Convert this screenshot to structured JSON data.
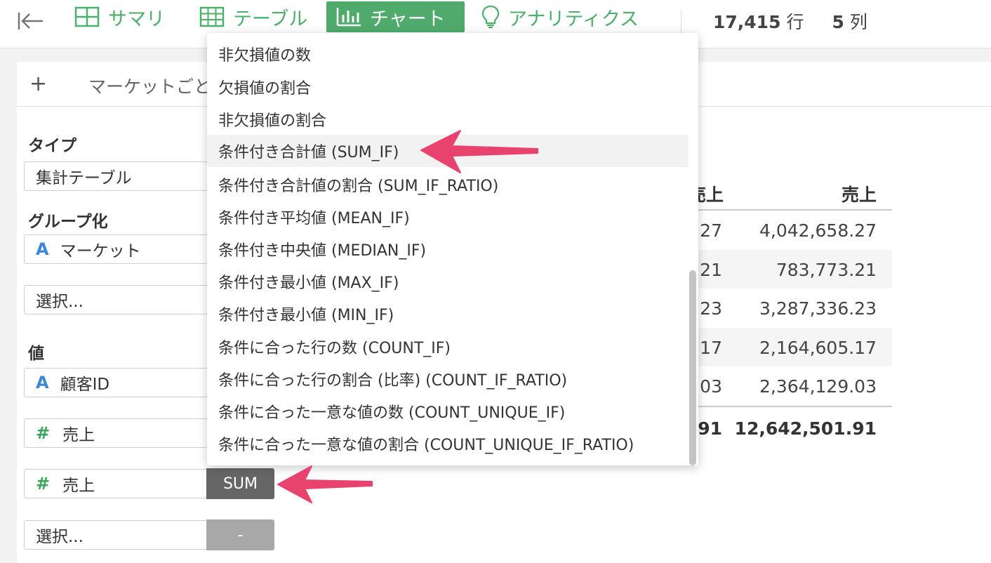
{
  "toolbar": {
    "tabs": [
      {
        "label": "サマリ",
        "icon": "grid-icon"
      },
      {
        "label": "テーブル",
        "icon": "table-icon"
      },
      {
        "label": "チャート",
        "icon": "bar-chart-icon"
      },
      {
        "label": "アナリティクス",
        "icon": "lightbulb-icon"
      }
    ],
    "active_tab": "チャート",
    "rows_count": "17,415",
    "rows_unit": "行",
    "cols_count": "5",
    "cols_unit": "列"
  },
  "panel": {
    "add_label": "+",
    "chart_tab_label": "マーケットごと"
  },
  "config": {
    "type_label": "タイプ",
    "type_value": "集計テーブル",
    "group_label": "グループ化",
    "group_field": "マーケット",
    "group_type_icon": "A",
    "group_placeholder": "選択...",
    "value_label": "値",
    "value_fields": [
      {
        "type_icon": "A",
        "name": "顧客ID"
      },
      {
        "type_icon": "#",
        "name": "売上"
      },
      {
        "type_icon": "#",
        "name": "売上",
        "agg": "SUM"
      }
    ],
    "value_placeholder": "選択...",
    "value_placeholder_agg": "-"
  },
  "table": {
    "headers": [
      "売上",
      "売上"
    ],
    "rows": [
      [
        ".27",
        "4,042,658.27"
      ],
      [
        ".21",
        "783,773.21"
      ],
      [
        ".23",
        "3,287,336.23"
      ],
      [
        ".17",
        "2,164,605.17"
      ],
      [
        ".03",
        "2,364,129.03"
      ]
    ],
    "total": [
      ".91",
      "12,642,501.91"
    ]
  },
  "dropdown": {
    "items": [
      "非欠損値の数",
      "欠損値の割合",
      "非欠損値の割合",
      "条件付き合計値 (SUM_IF)",
      "条件付き合計値の割合 (SUM_IF_RATIO)",
      "条件付き平均値 (MEAN_IF)",
      "条件付き中央値 (MEDIAN_IF)",
      "条件付き最小値 (MAX_IF)",
      "条件付き最小値 (MIN_IF)",
      "条件に合った行の数 (COUNT_IF)",
      "条件に合った行の割合 (比率) (COUNT_IF_RATIO)",
      "条件に合った一意な値の数 (COUNT_UNIQUE_IF)",
      "条件に合った一意な値の割合 (COUNT_UNIQUE_IF_RATIO)"
    ],
    "highlighted": "条件付き合計値 (SUM_IF)"
  },
  "colors": {
    "accent_green": "#4faa6c",
    "annotation_arrow": "#e8436e"
  }
}
